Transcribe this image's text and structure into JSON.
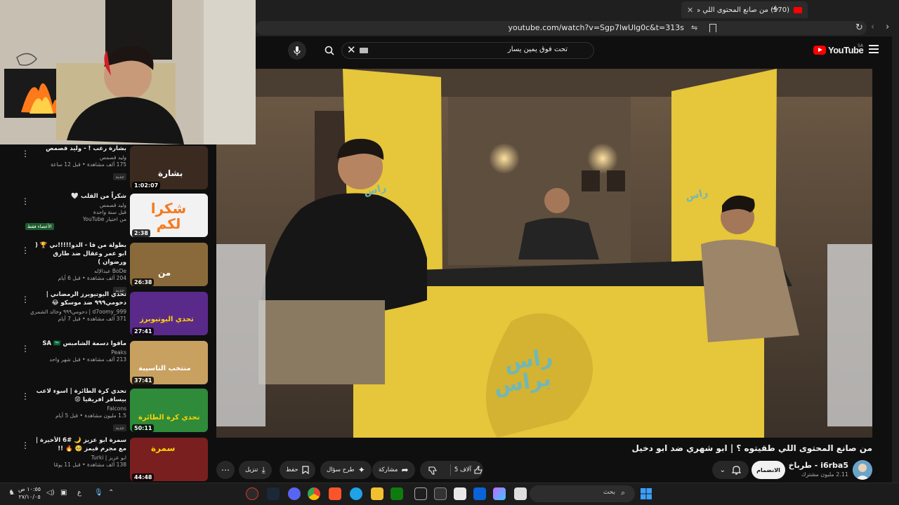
{
  "browser": {
    "tab_title": "(570) من صانع المحتوى اللي ط",
    "url": "youtube.com/watch?v=Sgp7lwUlg0c&t=313s"
  },
  "header": {
    "logo_text": "YouTube",
    "region": "SA",
    "search_value": "تحت فوق يمين يسار"
  },
  "video": {
    "title": "من صانع المحتوى اللي طقيتوه ؟ | ابو شهري ضد ابو دخيل",
    "set_text_1": "راس",
    "set_text_2": "براس",
    "channel": "i6rba5 - طرباخ",
    "subscribers": "2.11 مليون مشترك",
    "subscribe_label": "الانضمام",
    "likes": "5 آلاف",
    "share_label": "مشاركة",
    "ask_label": "طرح سؤال",
    "save_label": "حفظ",
    "download_label": "تنزيل"
  },
  "sidebar": {
    "items": [
      {
        "title": "بشارة رعب ! - وليد قصمص",
        "channel": "وليد قصمص",
        "stats": "175 ألف مشاهدة • قبل 12 ساعة",
        "badge": "جديد",
        "duration": "1:02:07",
        "thumb_text": "بشارة",
        "thumb_color": "#3a2a20"
      },
      {
        "title": "شكراً من القلب 🤍",
        "channel": "وليد قصمص",
        "stats": "قبل سنة واحدة",
        "badge": "من اختيار YouTube",
        "badge2": "الأعضاء فقط",
        "duration": "2:38",
        "thumb_text": "شكرا لكم",
        "thumb_color": "#f2f2f2"
      },
      {
        "title": "بطولة من قا - الدو!!!!!ني 🏆 ( ابو عمر وعقال ضد طارق ورضوان )",
        "channel": "BoDe عبدالإله",
        "stats": "204 ألف مشاهدة • قبل 6 أيام",
        "badge": "جديد",
        "duration": "26:38",
        "thumb_text": "من",
        "thumb_color": "#8a6a3a"
      },
      {
        "title": "تحدي اليوتيوبرز الرمضاني | دحومي٩٩٩ ضد موسكو 😂",
        "channel": "d7oomy_999 | دحومي٩٩٩ وخالد الشمري",
        "stats": "371 ألف مشاهدة • قبل 7 أيام",
        "badge": "",
        "duration": "27:41",
        "thumb_text": "تحدي اليوتيوبرز",
        "thumb_color": "#5a2a8a"
      },
      {
        "title": "ماقوا دسمة الشامبس SA 🇸🇦",
        "channel": "Peaks",
        "stats": "213 ألف مشاهدة • قبل شهر واحد",
        "badge": "",
        "duration": "37:41",
        "thumb_text": "منتخب التاسيبة",
        "thumb_color": "#c8a060"
      },
      {
        "title": "تحدي كرة الطائرة | اسوء لاعب بيسافر افريقيا 😡",
        "channel": "Falcons",
        "stats": "1.5 مليون مشاهدة • قبل 5 أيام",
        "badge": "جديد",
        "duration": "50:11",
        "thumb_text": "تحدي كرة الطائرة",
        "thumb_color": "#2f8a3a"
      },
      {
        "title": "سمرة ابو عزيز 🌙 #6 الأخيرة | مع مجرم قيمز 🥺 🔥 !!",
        "channel": "ابو عزيز | Turki",
        "stats": "138 ألف مشاهدة • قبل 11 يومًا",
        "badge": "",
        "duration": "44:48",
        "thumb_text": "سمرة",
        "thumb_color": "#7a1f1f"
      }
    ]
  },
  "taskbar": {
    "search_placeholder": "بحث",
    "time": "١٠:٥٥ ص",
    "date": "٢٧/١٠/٠٥",
    "lang": "ع"
  },
  "colors": {
    "yt_red": "#ff0000",
    "background": "#0f0f0f",
    "chip": "#272727",
    "set_yellow": "#e6c63a",
    "set_teal": "#6fb8b8"
  }
}
